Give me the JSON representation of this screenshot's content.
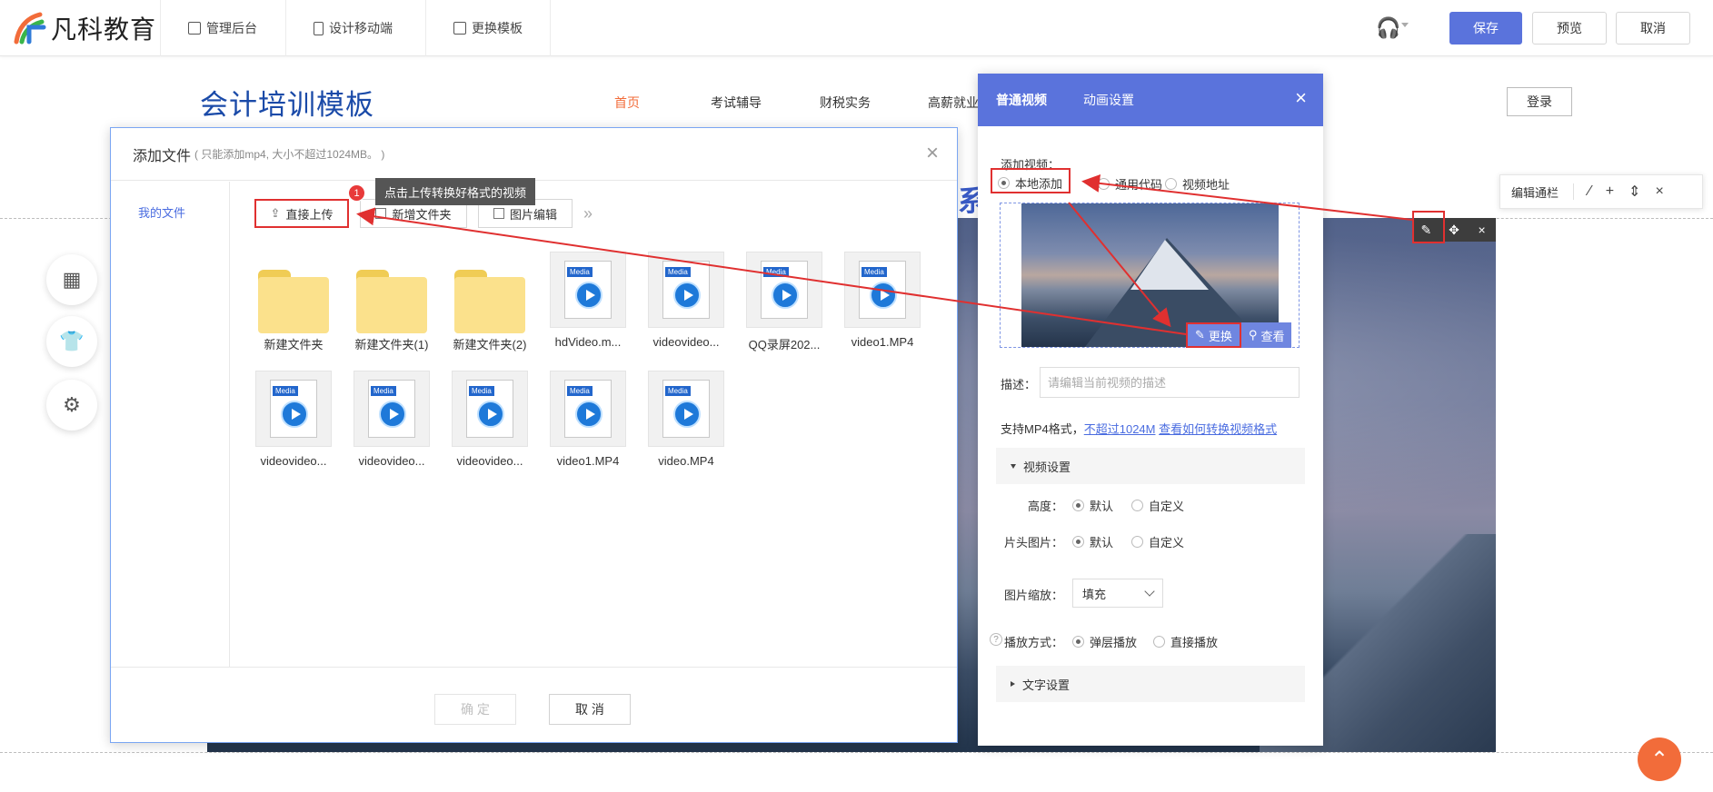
{
  "topbar": {
    "logo_text": "凡科教育",
    "nav": [
      {
        "label": "管理后台"
      },
      {
        "label": "设计移动端"
      },
      {
        "label": "更换模板"
      }
    ],
    "save_label": "保存",
    "preview_label": "预览",
    "cancel_label": "取消",
    "accent_color": "#5a73dc"
  },
  "site": {
    "title": "会计培训模板",
    "nav": [
      "首页",
      "考试辅导",
      "财税实务",
      "高薪就业"
    ],
    "login_label": "登录",
    "partial_heading": "系"
  },
  "edit_bar": {
    "label": "编辑通栏"
  },
  "file_dialog": {
    "title": "添加文件",
    "hint": "( 只能添加mp4, 大小不超过1024MB。 )",
    "sidebar_item": "我的文件",
    "tools": {
      "upload_label": "直接上传",
      "new_folder_label": "新增文件夹",
      "image_edit_label": "图片编辑"
    },
    "files": [
      {
        "name": "新建文件夹",
        "type": "folder"
      },
      {
        "name": "新建文件夹(1)",
        "type": "folder"
      },
      {
        "name": "新建文件夹(2)",
        "type": "folder"
      },
      {
        "name": "hdVideo.m...",
        "type": "video"
      },
      {
        "name": "videovideo...",
        "type": "video"
      },
      {
        "name": "QQ录屏202...",
        "type": "video"
      },
      {
        "name": "video1.MP4",
        "type": "video"
      },
      {
        "name": "videovideo...",
        "type": "video"
      },
      {
        "name": "videovideo...",
        "type": "video"
      },
      {
        "name": "videovideo...",
        "type": "video"
      },
      {
        "name": "video1.MP4",
        "type": "video"
      },
      {
        "name": "video.MP4",
        "type": "video"
      }
    ],
    "media_tag": "Media",
    "confirm_label": "确 定",
    "cancel_label": "取 消"
  },
  "tooltip": {
    "badge": "1",
    "text": "点击上传转换好格式的视频"
  },
  "video_panel": {
    "tabs": [
      "普通视频",
      "动画设置"
    ],
    "add_video_label": "添加视频：",
    "source_options": [
      "本地添加",
      "通用代码",
      "视频地址"
    ],
    "replace_label": "更换",
    "view_label": "查看",
    "desc_label": "描述：",
    "desc_placeholder": "请编辑当前视频的描述",
    "support_prefix": "支持MP4格式，",
    "support_link1": "不超过1024M",
    "support_link2": "查看如何转换视频格式",
    "video_settings_label": "视频设置",
    "height_label": "高度：",
    "cover_label": "片头图片：",
    "scale_label": "图片缩放：",
    "play_label": "播放方式：",
    "default_label": "默认",
    "custom_label": "自定义",
    "scale_value": "填充",
    "play_options": [
      "弹层播放",
      "直接播放"
    ],
    "text_settings_label": "文字设置"
  }
}
